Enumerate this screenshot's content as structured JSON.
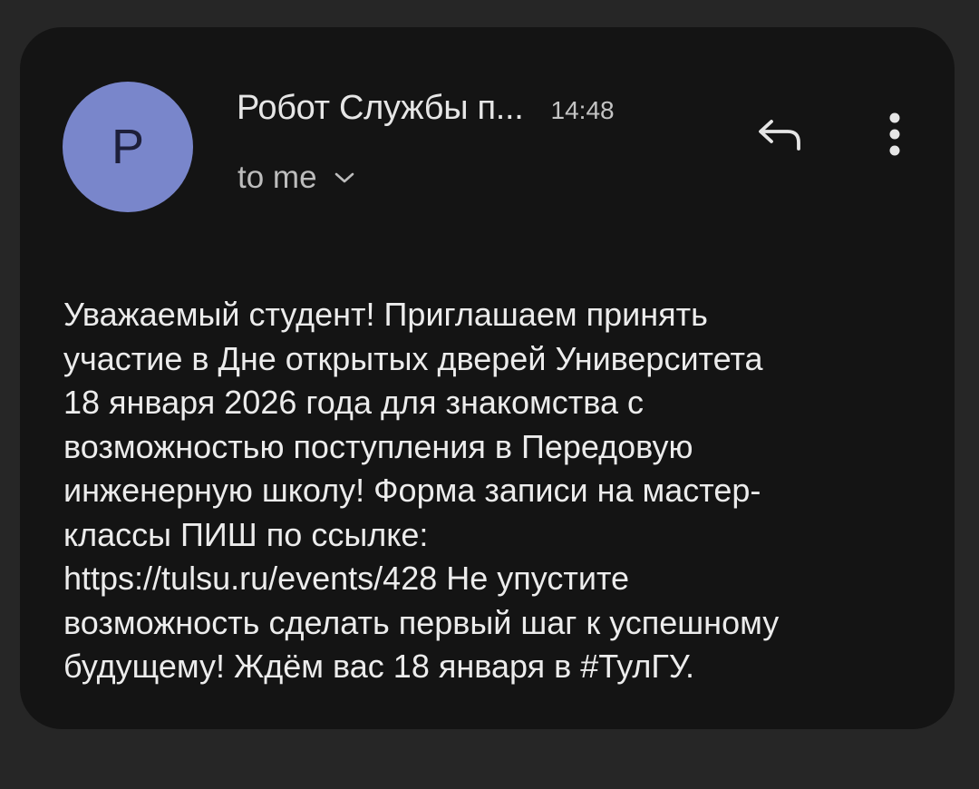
{
  "email": {
    "avatar_letter": "P",
    "avatar_color": "#7986cb",
    "sender_name": "Робот Службы п...",
    "time": "14:48",
    "recipient": "to me",
    "body_lines": [
      "Уважаемый студент! Приглашаем принять",
      "участие в Дне открытых дверей Университета",
      "18 января 2026 года для знакомства с",
      "возможностью поступления в Передовую",
      "инженерную школу! Форма записи на мастер-",
      "классы ПИШ по ссылке:",
      "https://tulsu.ru/events/428 Не упустите",
      "возможность сделать первый шаг к успешному",
      "будущему! Ждём вас 18 января в #ТулГУ."
    ]
  },
  "icons": {
    "reply": "reply-icon",
    "more": "more-vert-icon",
    "expand": "chevron-down-icon"
  },
  "colors": {
    "background": "#262626",
    "card": "#141414",
    "text_primary": "#ececec",
    "text_secondary": "#bdbdbd"
  }
}
